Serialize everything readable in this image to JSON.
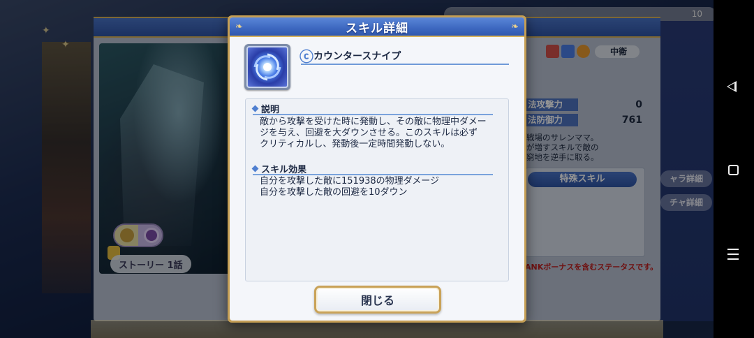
{
  "modal": {
    "title": "スキル詳細",
    "skill_icon": "vortex-skill-icon",
    "skill_name": "カウンタースナイプ",
    "description_heading": "説明",
    "description_lines": [
      "敵から攻撃を受けた時に発動し、その敵に物理中ダメー",
      "ジを与え、回避を大ダウンさせる。このスキルは必ず",
      "クリティカルし、発動後一定時間発動しない。"
    ],
    "effect_heading": "スキル効果",
    "effect_lines": [
      "自分を攻撃した敵に151938の物理ダメージ",
      "自分を攻撃した敵の回避を10ダウン"
    ],
    "close_label": "閉じる"
  },
  "background": {
    "story_badge": "ストーリー 1話",
    "position_label": "中衛",
    "stats": [
      {
        "label": "法攻撃力",
        "value": "0"
      },
      {
        "label": "法防御力",
        "value": "761"
      }
    ],
    "description_partial": [
      "戦場のサレンママ。",
      "が増すスキルで敵の",
      "窮地を逆手に取る。"
    ],
    "special_skill_button": "特殊スキル",
    "rank_note": "ANKボーナスを含むステータスです。",
    "side_buttons": [
      "ャラ詳細",
      "チャ詳細"
    ],
    "top_counter": "10"
  },
  "colors": {
    "header_blue": "#3d68c0",
    "gold_border": "#c49e54",
    "accent_blue": "#4f7fd0"
  }
}
